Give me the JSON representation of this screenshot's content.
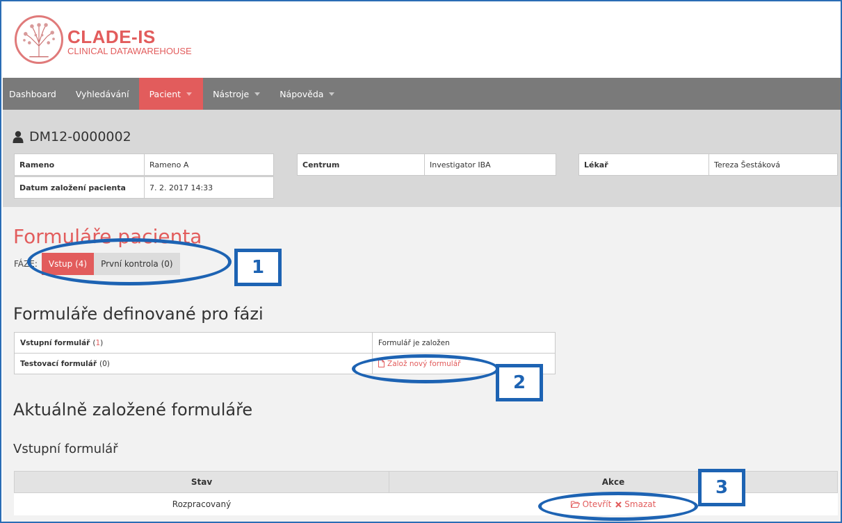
{
  "brand": {
    "title": "CLADE-IS",
    "subtitle": "CLINICAL DATAWAREHOUSE",
    "color": "#e25c5c"
  },
  "nav": {
    "items": [
      {
        "label": "Dashboard",
        "dropdown": false,
        "active": false
      },
      {
        "label": "Vyhledávání",
        "dropdown": false,
        "active": false
      },
      {
        "label": "Pacient",
        "dropdown": true,
        "active": true
      },
      {
        "label": "Nástroje",
        "dropdown": true,
        "active": false
      },
      {
        "label": "Nápověda",
        "dropdown": true,
        "active": false
      }
    ]
  },
  "patient": {
    "id": "DM12-0000002",
    "fields": {
      "rameno_label": "Rameno",
      "rameno_value": "Rameno A",
      "centrum_label": "Centrum",
      "centrum_value": "Investigator IBA",
      "lekar_label": "Lékař",
      "lekar_value": "Tereza Šestáková",
      "datum_label": "Datum založení pacienta",
      "datum_value": "7. 2. 2017 14:33"
    }
  },
  "forms": {
    "title": "Formuláře pacienta",
    "phase_label": "FÁZE:",
    "phases": [
      {
        "label": "Vstup (4)",
        "active": true
      },
      {
        "label": "První kontrola (0)",
        "active": false
      }
    ],
    "defined_title": "Formuláře definované pro fázi",
    "defined": [
      {
        "name": "Vstupní formulář",
        "count_open": " (",
        "count": "1",
        "count_close": ")",
        "status": "Formulář je založen"
      },
      {
        "name": "Testovací formulář",
        "count_text": "(0)",
        "action": "Založ nový formulář"
      }
    ],
    "current_title": "Aktuálně založené formuláře",
    "current_subtitle": "Vstupní formulář",
    "table": {
      "headers": [
        "Stav",
        "Akce"
      ],
      "row": {
        "stav": "Rozpracovaný",
        "open": "Otevřít",
        "delete": "Smazat"
      }
    }
  },
  "annotations": {
    "color": "#1d63b3",
    "labels": [
      "1",
      "2",
      "3"
    ]
  }
}
